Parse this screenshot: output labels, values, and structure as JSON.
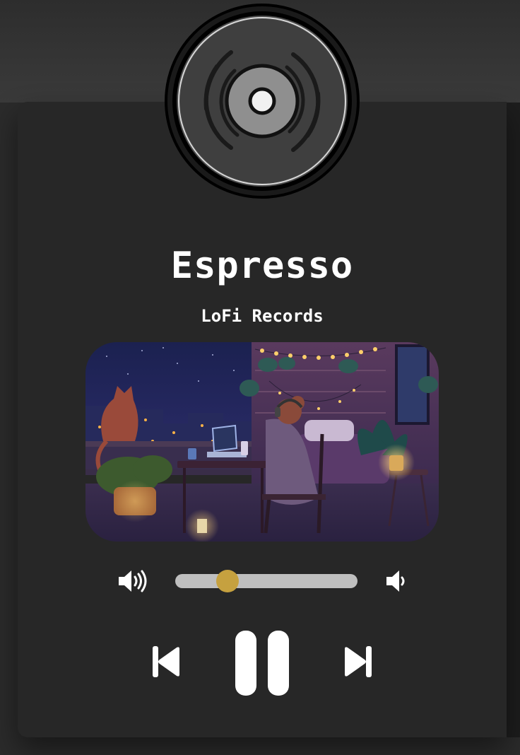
{
  "player": {
    "song_title": "Espresso",
    "artist": "LoFi Records",
    "artwork_alt": "Lofi girl studying on a balcony at night",
    "volume": {
      "level_fraction": 0.27
    },
    "controls": {
      "previous_icon": "skip-previous-icon",
      "pause_icon": "pause-icon",
      "next_icon": "skip-next-icon",
      "volume_up_icon": "volume-up-icon",
      "volume_down_icon": "volume-down-icon",
      "disc_icon": "vinyl-disc-icon"
    },
    "colors": {
      "accent": "#c6a13f",
      "card": "#272727",
      "text": "#ffffff",
      "track": "#bfbfbf"
    }
  }
}
